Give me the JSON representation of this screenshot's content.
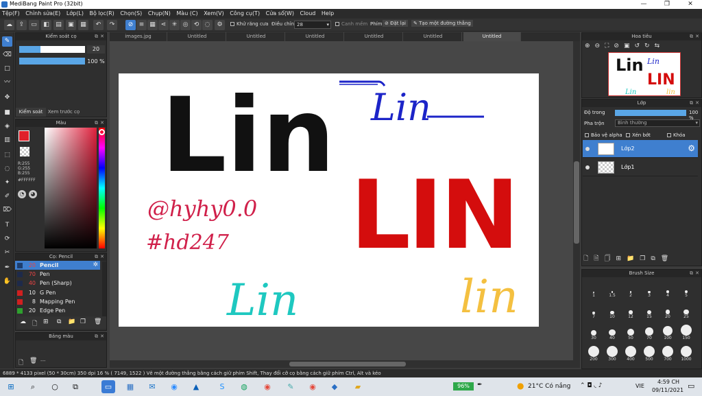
{
  "window": {
    "title": "MediBang Paint Pro (32bit)",
    "min": "—",
    "max": "❐",
    "close": "✕"
  },
  "menu": [
    "Tệp(F)",
    "Chỉnh sửa(E)",
    "Lớp(L)",
    "Bộ lọc(R)",
    "Chọn(S)",
    "Chụp(N)",
    "Màu (C)",
    "Xem(V)",
    "Công cụ(T)",
    "Cửa sổ(W)",
    "Cloud",
    "Help"
  ],
  "toolbar": {
    "antialias": "Khử răng cưa",
    "adjust": "Điều chỉnh",
    "adjust_value": "28",
    "smooth": "Canh mềm",
    "key_label": "Phím",
    "reset": "Đặt lại",
    "make_line": "Tạo một đường thẳng"
  },
  "brush_control": {
    "title": "Kiểm soát cọ",
    "size": "20",
    "size_fill": 0.32,
    "opacity": "100 %",
    "opacity_fill": 1.0,
    "tab1": "Kiểm soát cọ",
    "tab2": "Xem trước cọ"
  },
  "color_panel": {
    "title": "Màu",
    "r": "R:255",
    "g": "G:255",
    "b": "B:255",
    "hex": "#FFFFFF",
    "primary": "#e0202a",
    "secondary": "#ffffff"
  },
  "brush_list": {
    "title": "Cọ: Pencil",
    "items": [
      {
        "num": "20",
        "name": "Pencil",
        "color": "#1e3e6e"
      },
      {
        "num": "70",
        "name": "Pen",
        "color": "#1e2a4a"
      },
      {
        "num": "40",
        "name": "Pen (Sharp)",
        "color": "#1e2a4a"
      },
      {
        "num": "10",
        "name": "G Pen",
        "color": "#d02020"
      },
      {
        "num": "8",
        "name": "Mapping Pen",
        "color": "#d02020"
      },
      {
        "num": "20",
        "name": "Edge Pen",
        "color": "#2ea02e"
      }
    ]
  },
  "palette": {
    "title": "Bảng màu",
    "footer": "---"
  },
  "file_tabs": [
    "images.jpg",
    "Untitled",
    "Untitled",
    "Untitled",
    "Untitled",
    "Untitled",
    "Untitled"
  ],
  "canvas_text": {
    "big_lin": "Lin",
    "blue_lin": "Lin",
    "red_lin": "LIN",
    "handle": "@hyhy0.0",
    "tag": "#hd247",
    "teal_lin": "Lin",
    "gold_lin": "lin"
  },
  "navigator": {
    "title": "Hoa tiêu"
  },
  "layers": {
    "title": "Lớp",
    "opacity_label": "Độ trong",
    "opacity_value": "100 %",
    "blend_label": "Pha trộn",
    "blend_value": "Bình thường",
    "protect_alpha": "Bảo vệ alpha",
    "clip": "Xén bớt",
    "lock": "Khóa",
    "items": [
      "Lớp2",
      "Lớp1"
    ]
  },
  "brush_size": {
    "title": "Brush Size",
    "sizes": [
      "1",
      "1.5",
      "2",
      "3",
      "4",
      "5",
      "7",
      "10",
      "12",
      "15",
      "20",
      "25",
      "30",
      "40",
      "50",
      "70",
      "100",
      "150",
      "200",
      "300",
      "400",
      "500",
      "700",
      "1000"
    ]
  },
  "status": "6889 * 4133 pixel  (50 * 30cm)  350 dpi  16 %  ( 7149, 1522 )  Vẽ một đường thẳng bằng cách giữ phím Shift, Thay đổi cỡ cọ bằng cách giữ phím Ctrl, Alt và kéo",
  "taskbar": {
    "battery": "96%",
    "weather": "21°C  Có nắng",
    "lang": "VIE",
    "time": "4:59 CH",
    "date": "09/11/2021"
  }
}
